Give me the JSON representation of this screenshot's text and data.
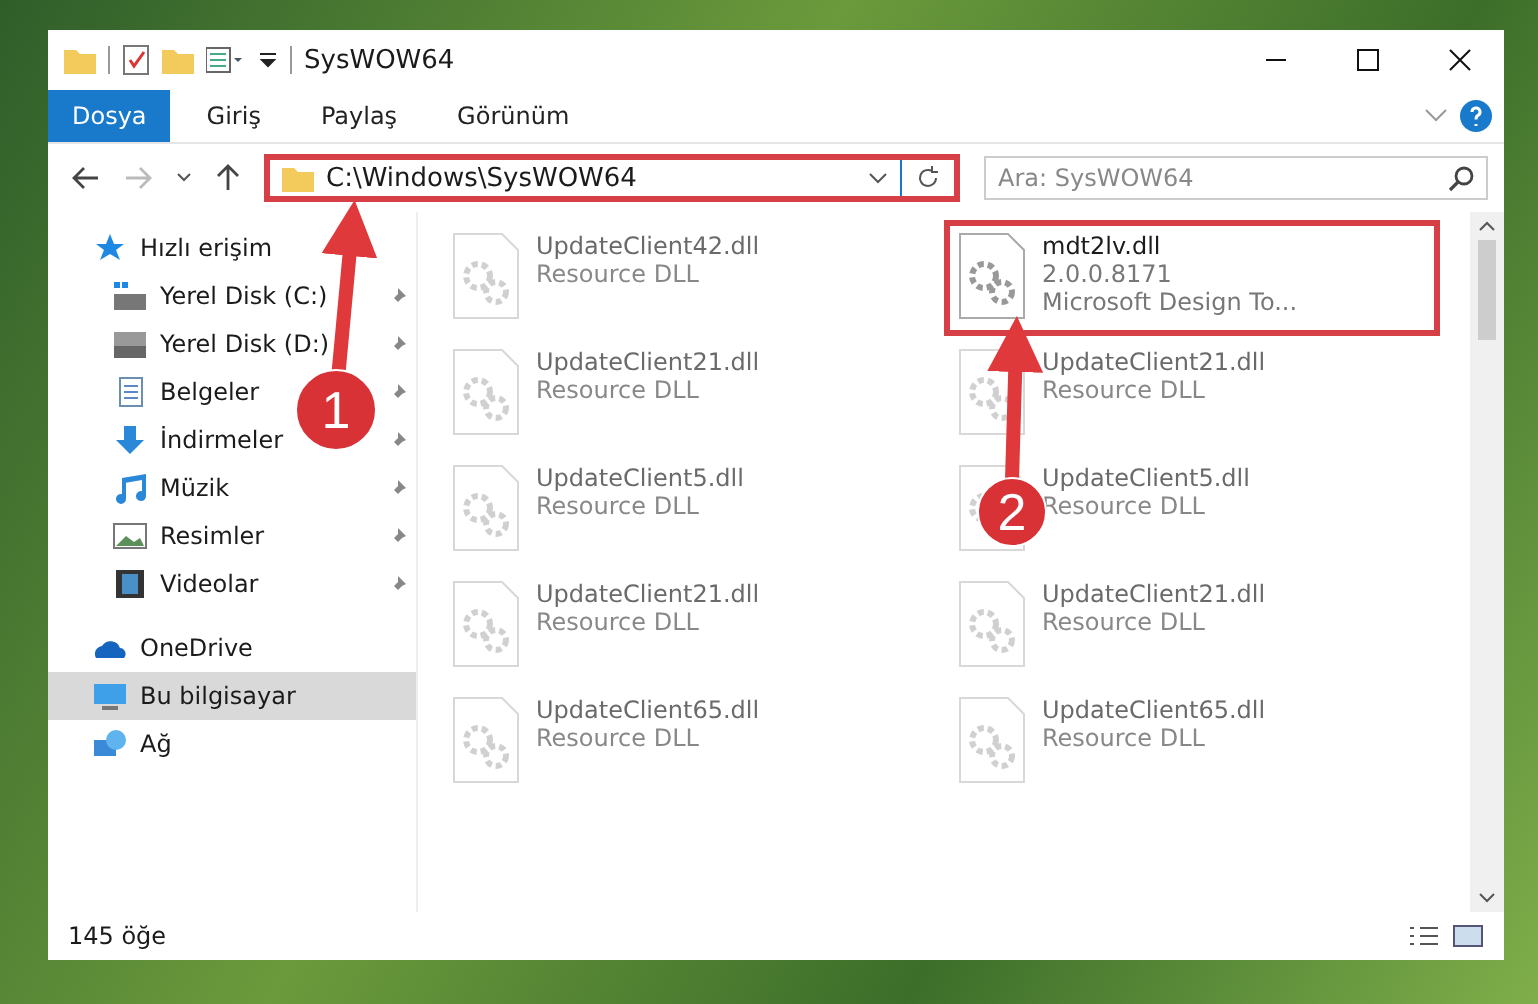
{
  "window": {
    "title": "SysWOW64"
  },
  "ribbon_tabs": [
    {
      "label": "Dosya",
      "selected": true
    },
    {
      "label": "Giriş",
      "selected": false
    },
    {
      "label": "Paylaş",
      "selected": false
    },
    {
      "label": "Görünüm",
      "selected": false
    }
  ],
  "address_bar": {
    "path": "C:\\Windows\\SysWOW64",
    "highlighted": true
  },
  "search": {
    "placeholder": "Ara: SysWOW64"
  },
  "sidebar": {
    "items": [
      {
        "label": "Hızlı erişim",
        "kind": "star",
        "selected": false,
        "children": [
          {
            "label": "Yerel Disk (C:)",
            "kind": "drive-c",
            "pinned": true
          },
          {
            "label": "Yerel Disk (D:)",
            "kind": "drive",
            "pinned": true
          },
          {
            "label": "Belgeler",
            "kind": "docs",
            "pinned": true
          },
          {
            "label": "İndirmeler",
            "kind": "download",
            "pinned": true
          },
          {
            "label": "Müzik",
            "kind": "music",
            "pinned": true
          },
          {
            "label": "Resimler",
            "kind": "pictures",
            "pinned": true
          },
          {
            "label": "Videolar",
            "kind": "video",
            "pinned": true
          }
        ]
      },
      {
        "label": "OneDrive",
        "kind": "cloud",
        "selected": false
      },
      {
        "label": "Bu bilgisayar",
        "kind": "computer",
        "selected": true
      },
      {
        "label": "Ağ",
        "kind": "network",
        "selected": false
      }
    ]
  },
  "files": [
    {
      "name": "UpdateClient42.dll",
      "lines": [
        "Resource DLL"
      ],
      "blurred": true,
      "highlighted": false
    },
    {
      "name": "mdt2lv.dll",
      "lines": [
        "2.0.0.8171",
        "Microsoft Design To..."
      ],
      "blurred": false,
      "highlighted": true
    },
    {
      "name": "UpdateClient21.dll",
      "lines": [
        "Resource DLL"
      ],
      "blurred": true,
      "highlighted": false
    },
    {
      "name": "UpdateClient21.dll",
      "lines": [
        "Resource DLL"
      ],
      "blurred": true,
      "highlighted": false
    },
    {
      "name": "UpdateClient5.dll",
      "lines": [
        "Resource DLL"
      ],
      "blurred": true,
      "highlighted": false
    },
    {
      "name": "UpdateClient5.dll",
      "lines": [
        "Resource DLL"
      ],
      "blurred": true,
      "highlighted": false
    },
    {
      "name": "UpdateClient21.dll",
      "lines": [
        "Resource DLL"
      ],
      "blurred": true,
      "highlighted": false
    },
    {
      "name": "UpdateClient21.dll",
      "lines": [
        "Resource DLL"
      ],
      "blurred": true,
      "highlighted": false
    },
    {
      "name": "UpdateClient65.dll",
      "lines": [
        "Resource DLL"
      ],
      "blurred": true,
      "highlighted": false
    },
    {
      "name": "UpdateClient65.dll",
      "lines": [
        "Resource DLL"
      ],
      "blurred": true,
      "highlighted": false
    }
  ],
  "status_bar": {
    "count": "145 öğe"
  },
  "annotations": [
    {
      "number": "1"
    },
    {
      "number": "2"
    }
  ]
}
